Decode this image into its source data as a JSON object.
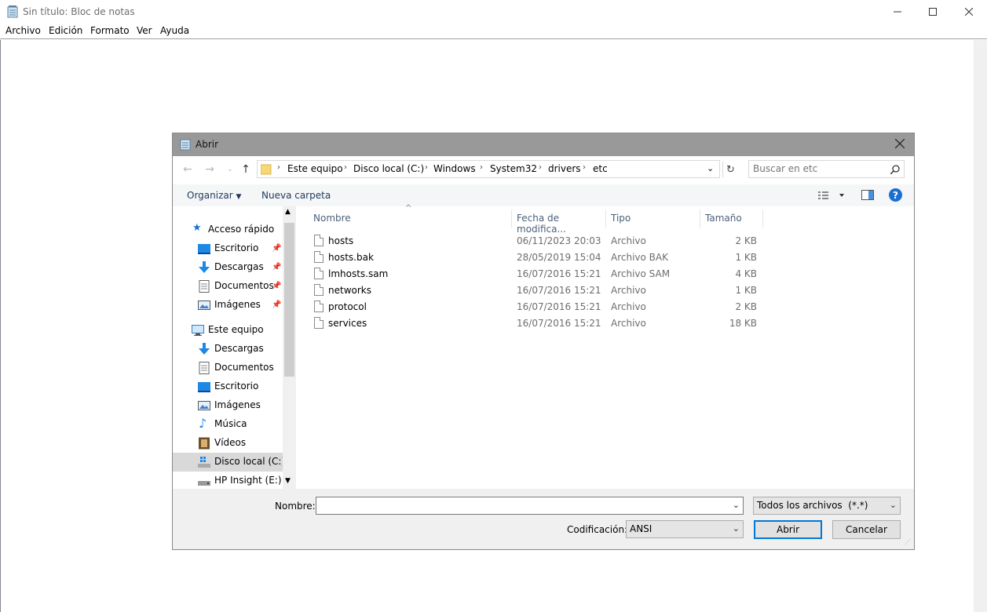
{
  "notepad": {
    "title": "Sin título: Bloc de notas",
    "menu": [
      "Archivo",
      "Edición",
      "Formato",
      "Ver",
      "Ayuda"
    ]
  },
  "dialog": {
    "title": "Abrir",
    "breadcrumb": [
      "Este equipo",
      "Disco local (C:)",
      "Windows",
      "System32",
      "drivers",
      "etc"
    ],
    "search_placeholder": "Buscar en etc",
    "toolbar": {
      "organize": "Organizar",
      "new_folder": "Nueva carpeta"
    },
    "nav": {
      "quick_access": "Acceso rápido",
      "quick_items": [
        "Escritorio",
        "Descargas",
        "Documentos",
        "Imágenes"
      ],
      "this_pc": "Este equipo",
      "pc_items": [
        "Descargas",
        "Documentos",
        "Escritorio",
        "Imágenes",
        "Música",
        "Vídeos",
        "Disco local (C:)",
        "HP Insight (E:)"
      ]
    },
    "columns": [
      "Nombre",
      "Fecha de modifica...",
      "Tipo",
      "Tamaño"
    ],
    "files": [
      {
        "name": "hosts",
        "date": "06/11/2023 20:03",
        "type": "Archivo",
        "size": "2 KB"
      },
      {
        "name": "hosts.bak",
        "date": "28/05/2019 15:04",
        "type": "Archivo BAK",
        "size": "1 KB"
      },
      {
        "name": "lmhosts.sam",
        "date": "16/07/2016 15:21",
        "type": "Archivo SAM",
        "size": "4 KB"
      },
      {
        "name": "networks",
        "date": "16/07/2016 15:21",
        "type": "Archivo",
        "size": "1 KB"
      },
      {
        "name": "protocol",
        "date": "16/07/2016 15:21",
        "type": "Archivo",
        "size": "2 KB"
      },
      {
        "name": "services",
        "date": "16/07/2016 15:21",
        "type": "Archivo",
        "size": "18 KB"
      }
    ],
    "bottom": {
      "name_label": "Nombre:",
      "name_value": "",
      "filter": "Todos los archivos  (*.*)",
      "encoding_label": "Codificación:",
      "encoding_value": "ANSI",
      "open": "Abrir",
      "cancel": "Cancelar"
    }
  }
}
